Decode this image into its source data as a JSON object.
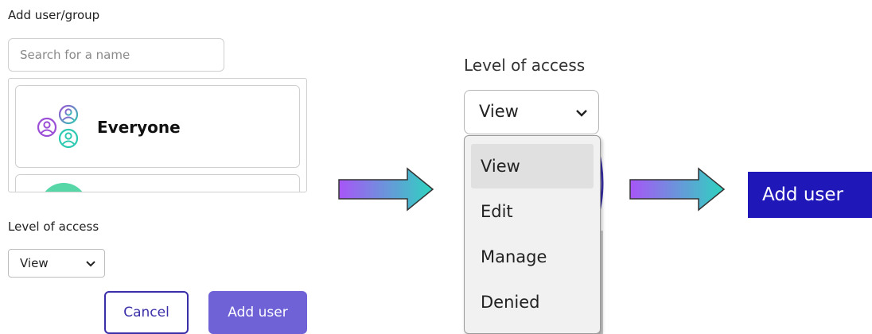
{
  "panel_1": {
    "title": "Add user/group",
    "search": {
      "placeholder": "Search for a name",
      "value": ""
    },
    "list_items": [
      {
        "label": "Everyone",
        "icon": "user-group-icon"
      }
    ],
    "level_label": "Level of access",
    "level_value": "View",
    "cancel_label": "Cancel",
    "add_label": "Add user"
  },
  "panel_2": {
    "level_label": "Level of access",
    "level_value": "View",
    "options": [
      "View",
      "Edit",
      "Manage",
      "Denied"
    ],
    "selected_option": "View"
  },
  "panel_3": {
    "add_label": "Add user"
  },
  "colors": {
    "accent_dark": "#1f17b8",
    "accent_light": "#6e62d6",
    "outline": "#3a2fa8",
    "arrow_start": "#a855f7",
    "arrow_end": "#2dd4bf"
  }
}
